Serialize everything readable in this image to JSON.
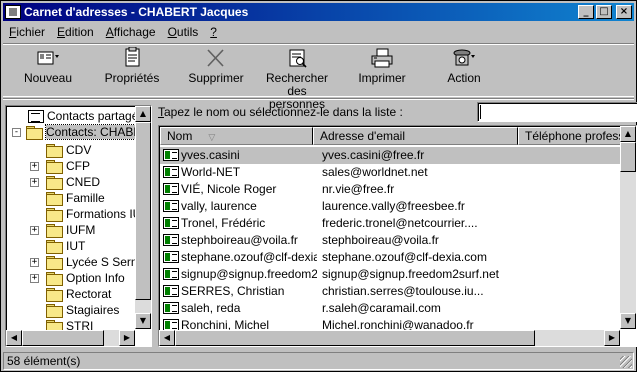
{
  "window": {
    "title": "Carnet d'adresses - CHABERT Jacques",
    "min_glyph": "_",
    "max_glyph": "□",
    "close_glyph": "×"
  },
  "menu": [
    {
      "label": "Fichier",
      "accel": "F",
      "rest": "ichier"
    },
    {
      "label": "Edition",
      "accel": "E",
      "rest": "dition"
    },
    {
      "label": "Affichage",
      "accel": "A",
      "rest": "ffichage"
    },
    {
      "label": "Outils",
      "accel": "O",
      "rest": "utils"
    },
    {
      "label": "?",
      "accel": "?",
      "rest": ""
    }
  ],
  "toolbar": {
    "new": "Nouveau",
    "properties": "Propriétés",
    "delete": "Supprimer",
    "find_line1": "Rechercher des",
    "find_line2": "personnes",
    "print": "Imprimer",
    "action": "Action"
  },
  "tree": {
    "shared": "Contacts partagés",
    "main": "Contacts: CHABERT Jacques",
    "folders": [
      {
        "label": "CDV",
        "expandable": false
      },
      {
        "label": "CFP",
        "expandable": true
      },
      {
        "label": "CNED",
        "expandable": true
      },
      {
        "label": "Famille",
        "expandable": false
      },
      {
        "label": "Formations IUFM",
        "expandable": false
      },
      {
        "label": "IUFM",
        "expandable": true
      },
      {
        "label": "IUT",
        "expandable": false
      },
      {
        "label": "Lycée S Sernin",
        "expandable": true
      },
      {
        "label": "Option Info",
        "expandable": true
      },
      {
        "label": "Rectorat",
        "expandable": false
      },
      {
        "label": "Stagiaires",
        "expandable": false
      },
      {
        "label": "STRI",
        "expandable": false
      }
    ]
  },
  "search": {
    "label_accel": "T",
    "label_rest": "apez le nom ou sélectionnez-le dans la liste :",
    "value": ""
  },
  "list": {
    "columns": [
      "Nom",
      "Adresse d'email",
      "Téléphone professionnel"
    ],
    "rows": [
      {
        "name": "yves.casini",
        "email": "yves.casini@free.fr",
        "selected": true
      },
      {
        "name": "World-NET",
        "email": "sales@worldnet.net",
        "selected": false
      },
      {
        "name": "VIÉ, Nicole Roger",
        "email": "nr.vie@free.fr",
        "selected": false
      },
      {
        "name": "vally, laurence",
        "email": "laurence.vally@freesbee.fr",
        "selected": false
      },
      {
        "name": "Tronel, Frédéric",
        "email": "frederic.tronel@netcourrier....",
        "selected": false
      },
      {
        "name": "stephboireau@voila.fr",
        "email": "stephboireau@voila.fr",
        "selected": false
      },
      {
        "name": "stephane.ozouf@clf-dexia....",
        "email": "stephane.ozouf@clf-dexia.com",
        "selected": false
      },
      {
        "name": "signup@signup.freedom2...",
        "email": "signup@signup.freedom2surf.net",
        "selected": false
      },
      {
        "name": "SERRES, Christian",
        "email": "christian.serres@toulouse.iu...",
        "selected": false
      },
      {
        "name": "saleh, reda",
        "email": "r.saleh@caramail.com",
        "selected": false
      },
      {
        "name": "Ronchini, Michel",
        "email": "Michel.ronchini@wanadoo.fr",
        "selected": false
      }
    ]
  },
  "status": {
    "count": "58 élément(s)"
  },
  "scroll": {
    "up": "▲",
    "down": "▼",
    "left": "◀",
    "right": "▶"
  }
}
